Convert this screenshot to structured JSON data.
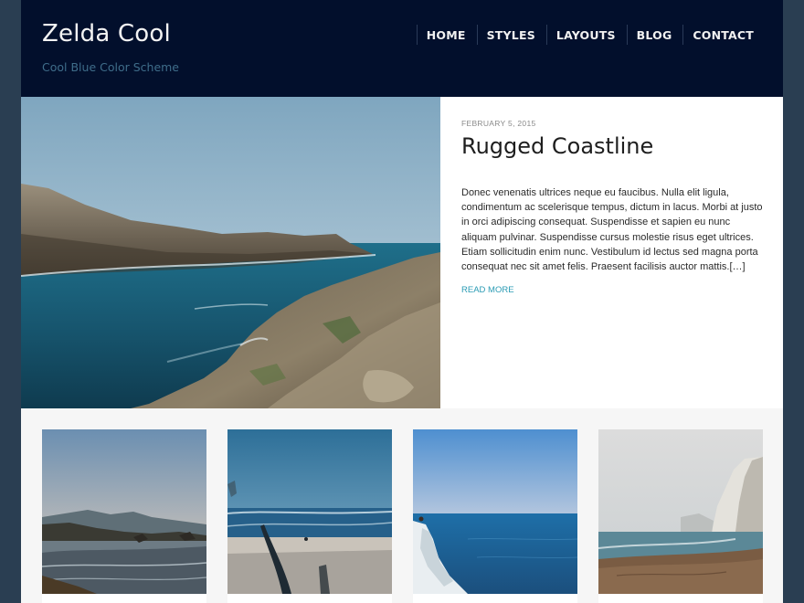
{
  "site": {
    "title": "Zelda Cool",
    "tagline": "Cool Blue Color Scheme"
  },
  "nav": {
    "items": [
      "HOME",
      "STYLES",
      "LAYOUTS",
      "BLOG",
      "CONTACT"
    ]
  },
  "featured_post": {
    "date": "FEBRUARY 5, 2015",
    "title": "Rugged Coastline",
    "excerpt": "Donec venenatis ultrices neque eu faucibus. Nulla elit ligula, condimentum ac scelerisque tempus, dictum in lacus. Morbi at justo in orci adipiscing consequat. Suspendisse et sapien eu nunc aliquam pulvinar. Suspendisse cursus molestie risus eget ultrices. Etiam sollicitudin enim nunc. Vestibulum id lectus sed magna porta consequat nec sit amet felis. Praesent facilisis auctor mattis.[…]",
    "read_more": "READ MORE"
  },
  "colors": {
    "header_bg": "#020f2c",
    "page_bg": "#2a3e52",
    "tagline": "#3f6d8a",
    "link_accent": "#2a9bb4"
  }
}
